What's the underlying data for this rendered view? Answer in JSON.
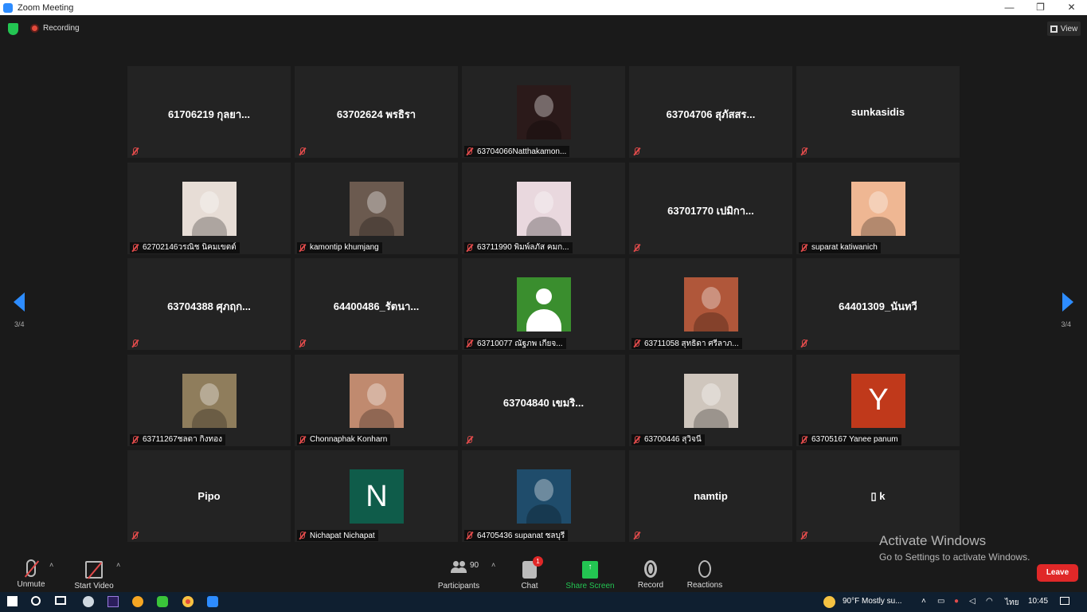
{
  "window": {
    "title": "Zoom Meeting",
    "minimize": "—",
    "restore": "❐",
    "close": "✕"
  },
  "meeting": {
    "recording_label": "Recording",
    "view_label": "View"
  },
  "colors": {
    "accent": "#2d8cff",
    "muted_mic": "#e04b4b",
    "leave": "#e02828",
    "share": "#23c552"
  },
  "pagination": {
    "left_page": "3/4",
    "right_page": "3/4"
  },
  "tiles": [
    {
      "big": "61706219 กุลยา...",
      "label": ""
    },
    {
      "big": "63702624 พรธิรา",
      "label": ""
    },
    {
      "big": "",
      "label": "63704066Natthakamon...",
      "avatar": "photo",
      "color": "#2b1a1a"
    },
    {
      "big": "63704706 สุภัสสร...",
      "label": ""
    },
    {
      "big": "sunkasidis",
      "label": ""
    },
    {
      "big": "",
      "label": "62702146วรณิช นิคมเขตต์",
      "avatar": "photo",
      "color": "#e7ddd6"
    },
    {
      "big": "",
      "label": "kamontip khumjang",
      "avatar": "photo",
      "color": "#6b5a4f"
    },
    {
      "big": "",
      "label": "63711990 พิมพ์ลภัส คมก...",
      "avatar": "photo",
      "color": "#e9d8de"
    },
    {
      "big": "63701770 เปมิกา...",
      "label": ""
    },
    {
      "big": "",
      "label": "suparat katiwanich",
      "avatar": "photo",
      "color": "#efb793"
    },
    {
      "big": "63704388 ศุภฤก...",
      "label": ""
    },
    {
      "big": "64400486_รัตนา...",
      "label": ""
    },
    {
      "big": "",
      "label": "63710077 ณัฐภพ เกียจ...",
      "avatar": "person",
      "color": "#3a8e2e"
    },
    {
      "big": "",
      "label": "63711058 สุทธิดา ศรีลาภ...",
      "avatar": "photo",
      "color": "#b0573a"
    },
    {
      "big": "64401309_นันทวี",
      "label": ""
    },
    {
      "big": "",
      "label": "63711267ชลดา  กิ่งทอง",
      "avatar": "photo",
      "color": "#8f7d5c"
    },
    {
      "big": "",
      "label": "Chonnaphak Konharn",
      "avatar": "photo",
      "color": "#c08a6f"
    },
    {
      "big": "63704840  เขมริ...",
      "label": ""
    },
    {
      "big": "",
      "label": "63700446 สุวิจนี",
      "avatar": "photo",
      "color": "#cfc6bd"
    },
    {
      "big": "",
      "label": "63705167 Yanee panum",
      "avatar": "letter",
      "letter": "Y",
      "color": "#c0391b"
    },
    {
      "big": "Pipo",
      "label": ""
    },
    {
      "big": "",
      "label": "Nichapat Nichapat",
      "avatar": "letter",
      "letter": "N",
      "color": "#0f5c4a"
    },
    {
      "big": "",
      "label": "64705436 supanat ชลบุรี",
      "avatar": "photo",
      "color": "#1f4c6b"
    },
    {
      "big": "namtip",
      "label": ""
    },
    {
      "big": "▯ k",
      "label": ""
    }
  ],
  "toolbar": {
    "unmute": "Unmute",
    "start_video": "Start Video",
    "participants": "Participants",
    "participants_count": "90",
    "chat": "Chat",
    "chat_badge": "1",
    "share_screen": "Share Screen",
    "record": "Record",
    "reactions": "Reactions",
    "leave": "Leave"
  },
  "watermark": {
    "line1": "Activate Windows",
    "line2": "Go to Settings to activate Windows."
  },
  "taskbar": {
    "weather": "90°F  Mostly su...",
    "lang": "ไทย",
    "time": "10:45"
  }
}
